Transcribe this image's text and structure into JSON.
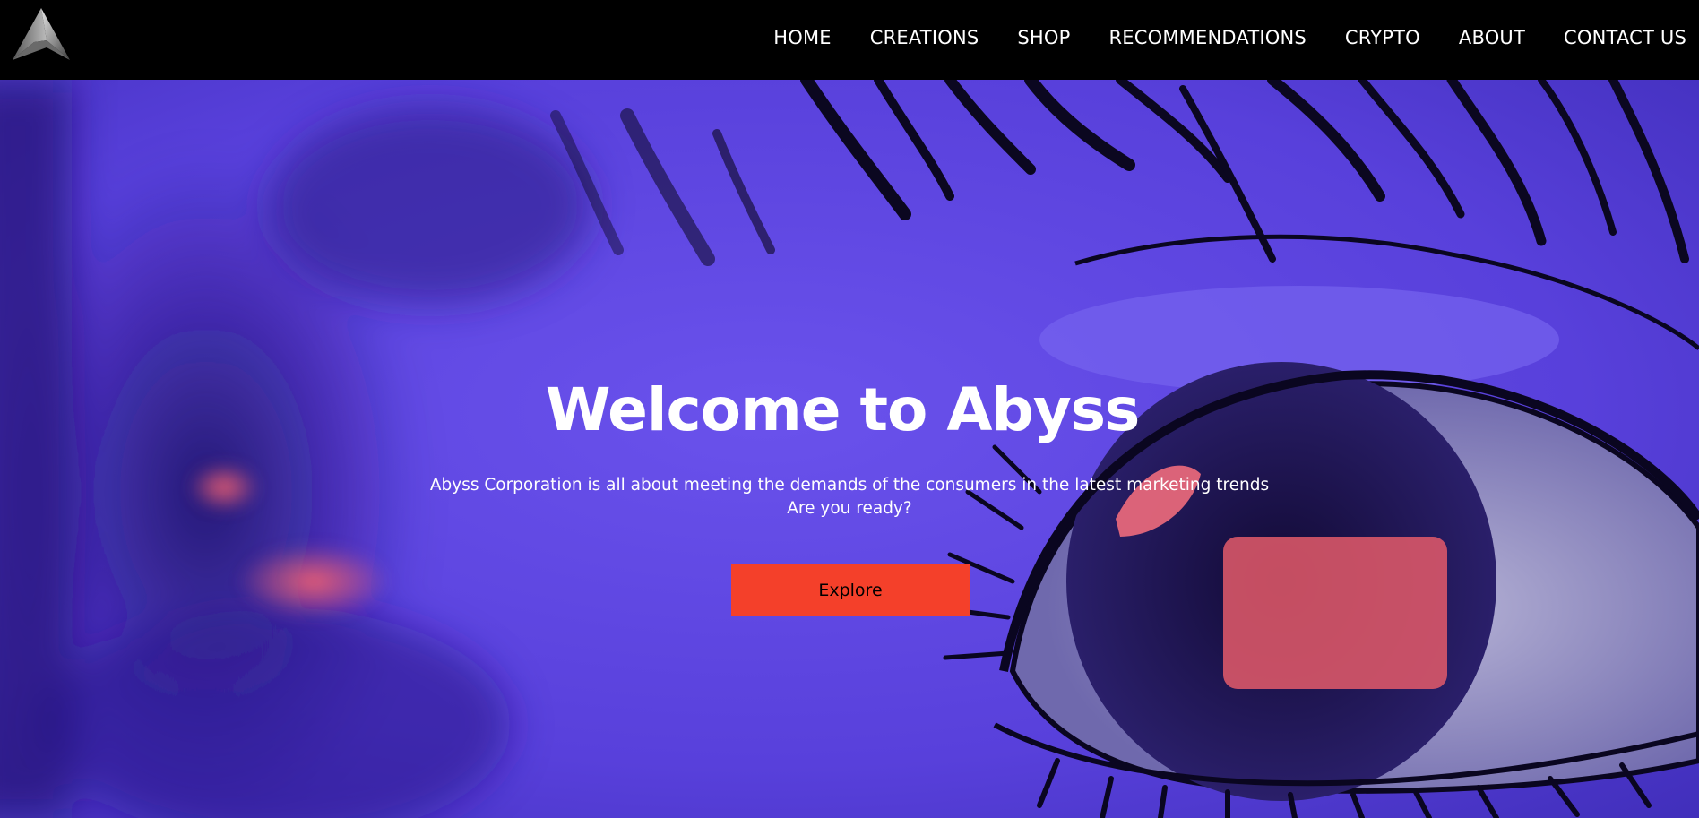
{
  "nav": {
    "logo_icon": "abyss-triangle-logo-icon",
    "items": [
      {
        "label": "HOME"
      },
      {
        "label": "CREATIONS"
      },
      {
        "label": "SHOP"
      },
      {
        "label": "RECOMMENDATIONS"
      },
      {
        "label": "CRYPTO"
      },
      {
        "label": "ABOUT"
      },
      {
        "label": "CONTACT US"
      }
    ]
  },
  "hero": {
    "background_image": "anime-eye-purple-illustration",
    "title": "Welcome to Abyss",
    "subtitle_line1": "Abyss Corporation is all about meeting the demands of the consumers in the latest marketing trends",
    "subtitle_line2": "Are you ready?",
    "cta_label": "Explore"
  },
  "colors": {
    "navbar_bg": "#000000",
    "hero_purple": "#5b45e0",
    "cta_bg": "#f4402a",
    "text": "#ffffff"
  }
}
